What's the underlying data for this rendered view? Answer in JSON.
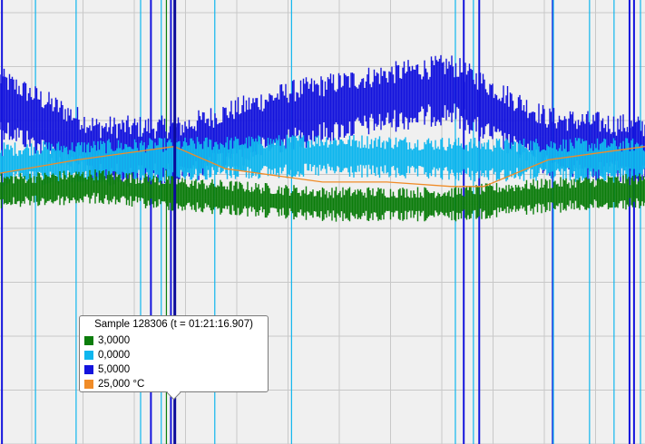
{
  "colors": {
    "background": "#f0f0f0",
    "grid": "#c8c8c8",
    "green": "#0c7d0c",
    "cyan": "#0fb6ee",
    "blue": "#1414dd",
    "orange": "#f08c28",
    "cursor": "#0a0a9a"
  },
  "chart_data": {
    "type": "line",
    "xlim": [
      0,
      100
    ],
    "ylim": [
      0,
      100
    ],
    "grid": true,
    "series": [
      {
        "color_key": "blue",
        "x": [
          0,
          15,
          28,
          45,
          60,
          70,
          75,
          85,
          100
        ],
        "y": [
          77,
          66,
          66,
          74,
          78,
          80,
          76,
          68,
          66
        ],
        "band": 8
      },
      {
        "color_key": "cyan",
        "x": [
          0,
          25,
          50,
          75,
          100
        ],
        "y": [
          63,
          64,
          65,
          64,
          64
        ],
        "band": 5
      },
      {
        "color_key": "green",
        "x": [
          0,
          15,
          30,
          50,
          70,
          85,
          100
        ],
        "y": [
          57,
          58,
          56,
          54,
          54,
          56,
          57
        ],
        "band": 4
      },
      {
        "color_key": "orange",
        "x": [
          0,
          12,
          27,
          35,
          50,
          60,
          70,
          75,
          85,
          100
        ],
        "y": [
          61,
          64,
          67,
          62,
          59,
          59,
          58,
          58,
          64,
          67
        ],
        "band": 0
      }
    ],
    "spikes": [
      {
        "color_key": "blue",
        "x": [
          0.3,
          23.4,
          26.5,
          71.9,
          74.3,
          85.7,
          97.6,
          98.3
        ]
      },
      {
        "color_key": "cyan",
        "x": [
          5.5,
          11.8,
          21.8,
          25.0,
          33.3,
          45.2,
          70.6,
          73.4,
          85.8,
          91.4,
          95.2,
          99.3
        ]
      },
      {
        "color_key": "green",
        "x": [
          25.8
        ]
      }
    ],
    "cursor_x": 27.1,
    "tooltip": {
      "title": "Sample 128306 (t = 01:21:16.907)",
      "entries": [
        {
          "value": "3,0000",
          "color_key": "green"
        },
        {
          "value": "0,0000",
          "color_key": "cyan"
        },
        {
          "value": "5,0000",
          "color_key": "blue"
        },
        {
          "value": "25,000 °C",
          "color_key": "orange"
        }
      ]
    }
  }
}
